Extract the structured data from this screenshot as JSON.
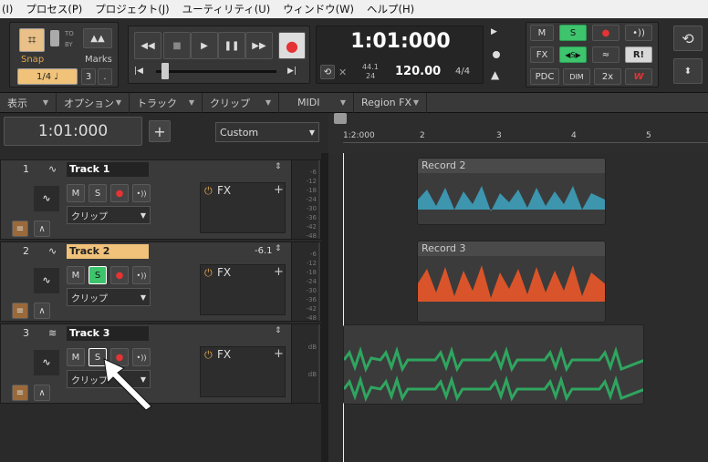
{
  "menu": [
    "(I)",
    "プロセス(P)",
    "プロジェクト(J)",
    "ユーティリティ(U)",
    "ウィンドウ(W)",
    "ヘルプ(H)"
  ],
  "snap": {
    "label": "Snap",
    "to": "TO",
    "by": "BY",
    "value": "1/4",
    "note": "♩",
    "marks_label": "Marks",
    "three": "3",
    "dot": "."
  },
  "transport": {
    "time": "1:01:000",
    "sample_rate": "44.1",
    "bit_depth": "24",
    "tempo": "120.00",
    "meter": "4/4",
    "rewind": "◀◀",
    "stop": "■",
    "play": "▶",
    "pause": "❚❚",
    "ffwd": "▶▶",
    "to_start": "|◀",
    "to_end": "▶|",
    "record": "●",
    "loop": "⟲",
    "up": "▶"
  },
  "mix": {
    "m": "M",
    "s": "S",
    "rec": "●",
    "mon": "•))",
    "fx": "FX",
    "link": "◀S▶",
    "r": "R!",
    "pdc": "PDC",
    "dim": "DIM",
    "x2": "2x",
    "w": "W"
  },
  "toolbar2": [
    "表示",
    "オプション",
    "トラック",
    "クリップ",
    "MIDI",
    "Region FX"
  ],
  "timeline": {
    "position": "1:01:000",
    "plus": "+",
    "preset": "Custom",
    "ruler": [
      "1:2:000",
      "2",
      "3",
      "4",
      "5"
    ]
  },
  "tracks": [
    {
      "num": "1",
      "name": "Track 1",
      "clip": "クリップ",
      "fx": "FX",
      "vol": "",
      "m": "M",
      "s": "S"
    },
    {
      "num": "2",
      "name": "Track 2",
      "clip": "クリップ",
      "fx": "FX",
      "vol": "-6.1",
      "m": "M",
      "s": "S"
    },
    {
      "num": "3",
      "name": "Track 3",
      "clip": "クリップ",
      "fx": "FX",
      "vol": "",
      "m": "M",
      "s": "S"
    }
  ],
  "clips": [
    {
      "name": "Record 2",
      "color": "#3ea0bb"
    },
    {
      "name": "Record 3",
      "color": "#d9542a"
    },
    {
      "name": "",
      "color": "#2fa55f"
    }
  ],
  "colors": {
    "accent": "#3ec46d",
    "selected_track": "#f0c27a"
  }
}
